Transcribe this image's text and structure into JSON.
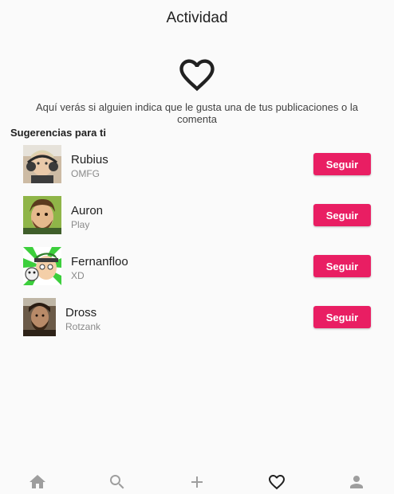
{
  "header": {
    "title": "Actividad"
  },
  "empty_state": {
    "icon": "heart-outline-icon",
    "message": "Aquí verás si alguien indica que le gusta una de tus publicaciones o la comenta"
  },
  "suggestions": {
    "title": "Sugerencias para ti",
    "follow_label": "Seguir",
    "users": [
      {
        "name": "Rubius",
        "subtitle": "OMFG"
      },
      {
        "name": "Auron",
        "subtitle": "Play"
      },
      {
        "name": "Fernanfloo",
        "subtitle": "XD"
      },
      {
        "name": "Dross",
        "subtitle": "Rotzank"
      }
    ]
  },
  "bottom_nav": {
    "items": [
      "home-icon",
      "search-icon",
      "add-icon",
      "heart-icon",
      "profile-icon"
    ],
    "active": "heart-icon"
  },
  "colors": {
    "accent": "#e91e63",
    "icon_inactive": "#9e9e9e",
    "icon_active": "#212121",
    "background": "#fafafa"
  }
}
